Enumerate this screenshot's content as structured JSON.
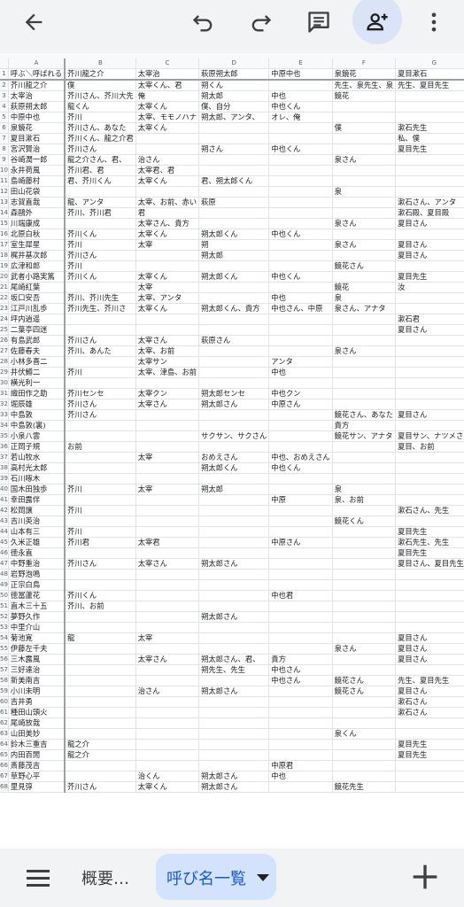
{
  "toolbar": {
    "back": "back-arrow-icon",
    "undo": "undo-icon",
    "redo": "redo-icon",
    "comment": "comment-icon",
    "share": "add-person-icon",
    "more": "more-vert-icon"
  },
  "sheet": {
    "column_letters": [
      "A",
      "B",
      "C",
      "D",
      "E",
      "F",
      "G",
      "H"
    ],
    "rows": [
      [
        "呼ぶ＼呼ばれる",
        "芥川龍之介",
        "太宰治",
        "萩原朔太郎",
        "中原中也",
        "泉鏡花",
        "夏目漱石",
        "宮沢賢治"
      ],
      [
        "芥川龍之介",
        "僕",
        "太宰くん、君",
        "朔くん",
        "",
        "先生、泉先生、泉",
        "先生、夏目先生",
        ""
      ],
      [
        "太宰治",
        "芥川さん、芥川大先",
        "俺",
        "朔太郎",
        "中也",
        "鏡花",
        "",
        ""
      ],
      [
        "萩原朔太郎",
        "龍くん",
        "太宰くん",
        "僕、自分",
        "中也くん",
        "",
        "",
        "賢治くん"
      ],
      [
        "中原中也",
        "芥川",
        "太宰、モモノハナ",
        "朔太郎、アンタ、",
        "オレ、俺",
        "",
        "",
        "賢治先生"
      ],
      [
        "泉鏡花",
        "芥川さん、あなた",
        "太宰くん",
        "",
        "",
        "僕",
        "漱石先生",
        ""
      ],
      [
        "夏目漱石",
        "芥川くん、龍之介君",
        "",
        "",
        "",
        "",
        "私、僕",
        "賢治くん"
      ],
      [
        "宮沢賢治",
        "芥川さん",
        "",
        "朔さん",
        "中也くん",
        "",
        "夏目先生",
        "ボク"
      ],
      [
        "谷崎潤一郎",
        "龍之介さん、君、",
        "治さん",
        "",
        "",
        "泉さん",
        "",
        "君、賢治さん"
      ],
      [
        "永井荷風",
        "芥川君、君",
        "太宰君、君",
        "",
        "",
        "",
        "",
        "賢治君"
      ],
      [
        "島崎藤村",
        "君、芥川くん",
        "太宰くん",
        "君、朔太郎くん",
        "",
        "",
        "",
        ""
      ],
      [
        "田山花袋",
        "",
        "",
        "",
        "",
        "泉",
        "",
        ""
      ],
      [
        "志賀直哉",
        "龍、アンタ",
        "太宰、お前、赤い",
        "萩原",
        "",
        "",
        "漱石さん、アンタ",
        ""
      ],
      [
        "森鷗外",
        "芥川、芥川君",
        "君",
        "",
        "",
        "",
        "漱石殿、夏目殿",
        ""
      ],
      [
        "川端康成",
        "",
        "太宰さん、貴方",
        "",
        "",
        "泉さん",
        "夏目さん",
        ""
      ],
      [
        "北原白秋",
        "芥川くん",
        "太宰くん",
        "朔太郎くん",
        "中也くん",
        "",
        "",
        ""
      ],
      [
        "室生犀星",
        "芥川",
        "太宰",
        "朔",
        "",
        "泉さん",
        "夏目さん",
        ""
      ],
      [
        "梶井基次郎",
        "芥川さん",
        "",
        "朔太郎",
        "",
        "",
        "夏目さん",
        ""
      ],
      [
        "広津和郎",
        "芥川",
        "",
        "",
        "",
        "鏡花さん",
        "",
        ""
      ],
      [
        "武者小路実篤",
        "芥川くん",
        "太宰くん",
        "朔太郎くん",
        "中也くん",
        "",
        "夏目先生",
        ""
      ],
      [
        "尾崎紅葉",
        "",
        "太宰",
        "",
        "",
        "鏡花",
        "汝",
        ""
      ],
      [
        "坂口安吾",
        "芥川、芥川先生",
        "太宰、アンタ",
        "",
        "中也",
        "泉",
        "",
        ""
      ],
      [
        "江戸川乱歩",
        "芥川先生、芥川さ",
        "太宰くん",
        "朔太郎くん、貴方",
        "中也さん、中原",
        "泉さん、アナタ",
        "",
        "賢治くん"
      ],
      [
        "坪内逍遥",
        "",
        "",
        "",
        "",
        "",
        "漱石君",
        ""
      ],
      [
        "二葉亭四迷",
        "",
        "",
        "",
        "",
        "",
        "夏目さん",
        ""
      ],
      [
        "有島武郎",
        "芥川さん",
        "太宰さん",
        "萩原さん",
        "",
        "",
        "",
        ""
      ],
      [
        "佐藤春夫",
        "芥川、あんた",
        "太宰、お前",
        "",
        "",
        "泉さん",
        "",
        ""
      ],
      [
        "小林多喜二",
        "",
        "太宰サン",
        "",
        "アンタ",
        "",
        "",
        "賢治サン"
      ],
      [
        "井伏鱒二",
        "芥川",
        "太宰、津島、お前",
        "",
        "中也",
        "",
        "",
        "賢治"
      ],
      [
        "横光利一",
        "",
        "",
        "",
        "",
        "",
        "",
        ""
      ],
      [
        "織田作之助",
        "芥川センセ",
        "太宰クン",
        "朔太郎センセ",
        "中也クン",
        "",
        "",
        "賢治クン"
      ],
      [
        "堀辰雄",
        "芥川さん",
        "太宰さん",
        "朔太郎さん",
        "中原さん",
        "",
        "",
        "賢治さん"
      ],
      [
        "中島敦",
        "芥川さん",
        "",
        "",
        "",
        "鏡花さん、あなた",
        "夏目さん",
        "賢治さん"
      ],
      [
        "中島敦(裏)",
        "",
        "",
        "",
        "",
        "貴方",
        "",
        ""
      ],
      [
        "小泉八雲",
        "",
        "",
        "サクサン、サクさん",
        "",
        "鏡花サン、アナタ",
        "夏目サン、ナツメさん",
        ""
      ],
      [
        "正岡子規",
        "お前",
        "",
        "",
        "",
        "",
        "夏目、お前",
        ""
      ],
      [
        "若山牧水",
        "",
        "太宰",
        "おめえさん",
        "中也、おめえさん",
        "",
        "",
        ""
      ],
      [
        "高村光太郎",
        "",
        "",
        "朔太郎くん",
        "中也くん",
        "",
        "",
        "賢治くん"
      ],
      [
        "石川啄木",
        "",
        "",
        "",
        "",
        "",
        "",
        "賢治"
      ],
      [
        "国木田独歩",
        "芥川",
        "太宰",
        "朔太郎",
        "",
        "泉",
        "",
        ""
      ],
      [
        "幸田露伴",
        "",
        "",
        "",
        "中原",
        "泉、お前",
        "",
        ""
      ],
      [
        "松岡譲",
        "芥川",
        "",
        "",
        "",
        "",
        "漱石さん、先生",
        ""
      ],
      [
        "吉川英治",
        "",
        "",
        "",
        "",
        "鏡花くん",
        "",
        ""
      ],
      [
        "山本有三",
        "芥川",
        "",
        "",
        "",
        "",
        "夏目先生",
        "賢治ちゃん"
      ],
      [
        "久米正雄",
        "芥川君",
        "太宰君",
        "",
        "中原さん",
        "",
        "漱石先生、先生",
        "賢治さん"
      ],
      [
        "徳永直",
        "",
        "",
        "",
        "",
        "",
        "夏目先生",
        ""
      ],
      [
        "中野重治",
        "芥川さん",
        "太宰さん",
        "朔太郎さん",
        "",
        "",
        "夏目さん、夏目先生",
        ""
      ],
      [
        "岩野泡鳴",
        "",
        "",
        "",
        "",
        "",
        "",
        ""
      ],
      [
        "正宗白鳥",
        "",
        "",
        "",
        "",
        "",
        "",
        ""
      ],
      [
        "徳冨蘆花",
        "芥川くん",
        "",
        "",
        "中也君",
        "",
        "",
        ""
      ],
      [
        "直木三十五",
        "芥川、お前",
        "",
        "",
        "",
        "",
        "",
        ""
      ],
      [
        "夢野久作",
        "",
        "",
        "朔太郎さん",
        "",
        "",
        "",
        ""
      ],
      [
        "中里介山",
        "",
        "",
        "",
        "",
        "",
        "",
        "賢治"
      ],
      [
        "菊池寛",
        "龍",
        "太宰",
        "",
        "",
        "",
        "夏目さん",
        ""
      ],
      [
        "伊藤左千夫",
        "",
        "",
        "",
        "",
        "泉さん",
        "夏目さん",
        ""
      ],
      [
        "三木露風",
        "",
        "太宰さん",
        "朔太郎さん、君、",
        "貴方",
        "",
        "夏目さん",
        ""
      ],
      [
        "三好達治",
        "",
        "",
        "朔先生、先生",
        "中也さん",
        "",
        "",
        "賢治さん"
      ],
      [
        "新美南吉",
        "",
        "",
        "",
        "中也さん",
        "鏡花さん",
        "先生、夏目先生",
        "けんちゃん、賢"
      ],
      [
        "小川未明",
        "",
        "治さん",
        "朔太郎さん",
        "",
        "鏡花さん",
        "夏目さん",
        ""
      ],
      [
        "吉井勇",
        "",
        "",
        "",
        "",
        "",
        "漱石さん",
        ""
      ],
      [
        "種田山頭火",
        "",
        "",
        "",
        "",
        "",
        "漱石さん",
        "賢治"
      ],
      [
        "尾崎放哉",
        "",
        "",
        "",
        "",
        "",
        "",
        ""
      ],
      [
        "山田美妙",
        "",
        "",
        "",
        "",
        "泉くん",
        "",
        ""
      ],
      [
        "鈴木三重吉",
        "龍之介",
        "",
        "",
        "",
        "",
        "夏目先生",
        ""
      ],
      [
        "内田百閒",
        "龍之介",
        "",
        "",
        "",
        "",
        "夏目先生",
        ""
      ],
      [
        "斎藤茂吉",
        "",
        "",
        "",
        "中原君",
        "",
        "",
        ""
      ],
      [
        "草野心平",
        "",
        "治くん",
        "朔太郎さん",
        "中也",
        "",
        "",
        "賢治"
      ],
      [
        "里見弴",
        "芥川さん",
        "太宰くん",
        "朔太郎さん",
        "",
        "鏡花先生",
        "",
        ""
      ]
    ]
  },
  "bottom_bar": {
    "menu": "hamburger-menu-icon",
    "tab_overview": "概要…",
    "tab_active": "呼び名一覧",
    "add": "plus-icon"
  }
}
